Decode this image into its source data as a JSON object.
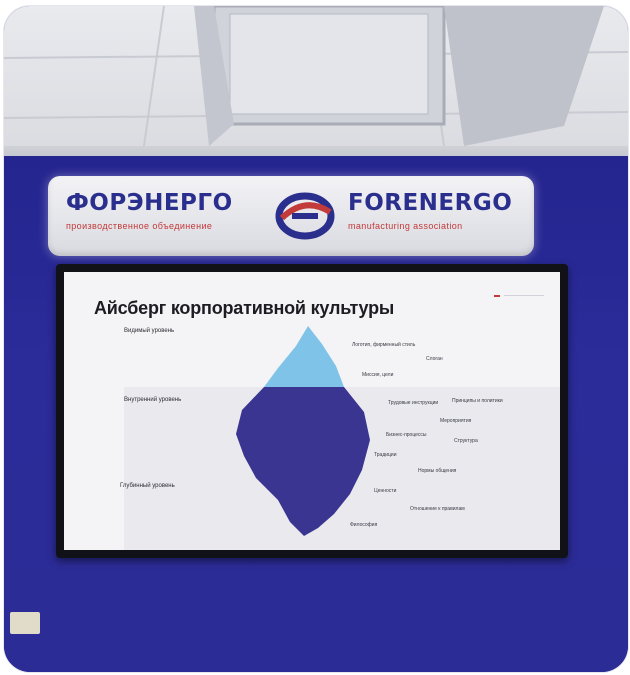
{
  "sign": {
    "name_ru": "ФОРЭНЕРГО",
    "sub_ru": "производственное объединение",
    "name_en": "FORENERGO",
    "sub_en": "manufacturing association",
    "brand_blue": "#2a2f8e",
    "brand_red": "#c23a3a"
  },
  "slide": {
    "title": "Айсберг корпоративной культуры",
    "levels": {
      "surface": "Видимый уровень",
      "inner": "Внутренний уровень",
      "deep": "Глубинный уровень"
    },
    "tags": {
      "t1": "Логотип, фирменный стиль",
      "t2": "Слоган",
      "t3": "Миссия, цели",
      "t4": "Трудовые инструкции",
      "t5": "Принципы и политики",
      "t6": "Мероприятия",
      "t7": "Бизнес-процессы",
      "t8": "Структура",
      "t9": "Традиции",
      "t10": "Нормы общения",
      "t11": "Ценности",
      "t12": "Отношение к правилам",
      "t13": "Философия"
    },
    "colors": {
      "tip": "#7fc3e8",
      "body": "#3a3590"
    }
  },
  "scene": {
    "wall_color": "#2a2a96"
  }
}
